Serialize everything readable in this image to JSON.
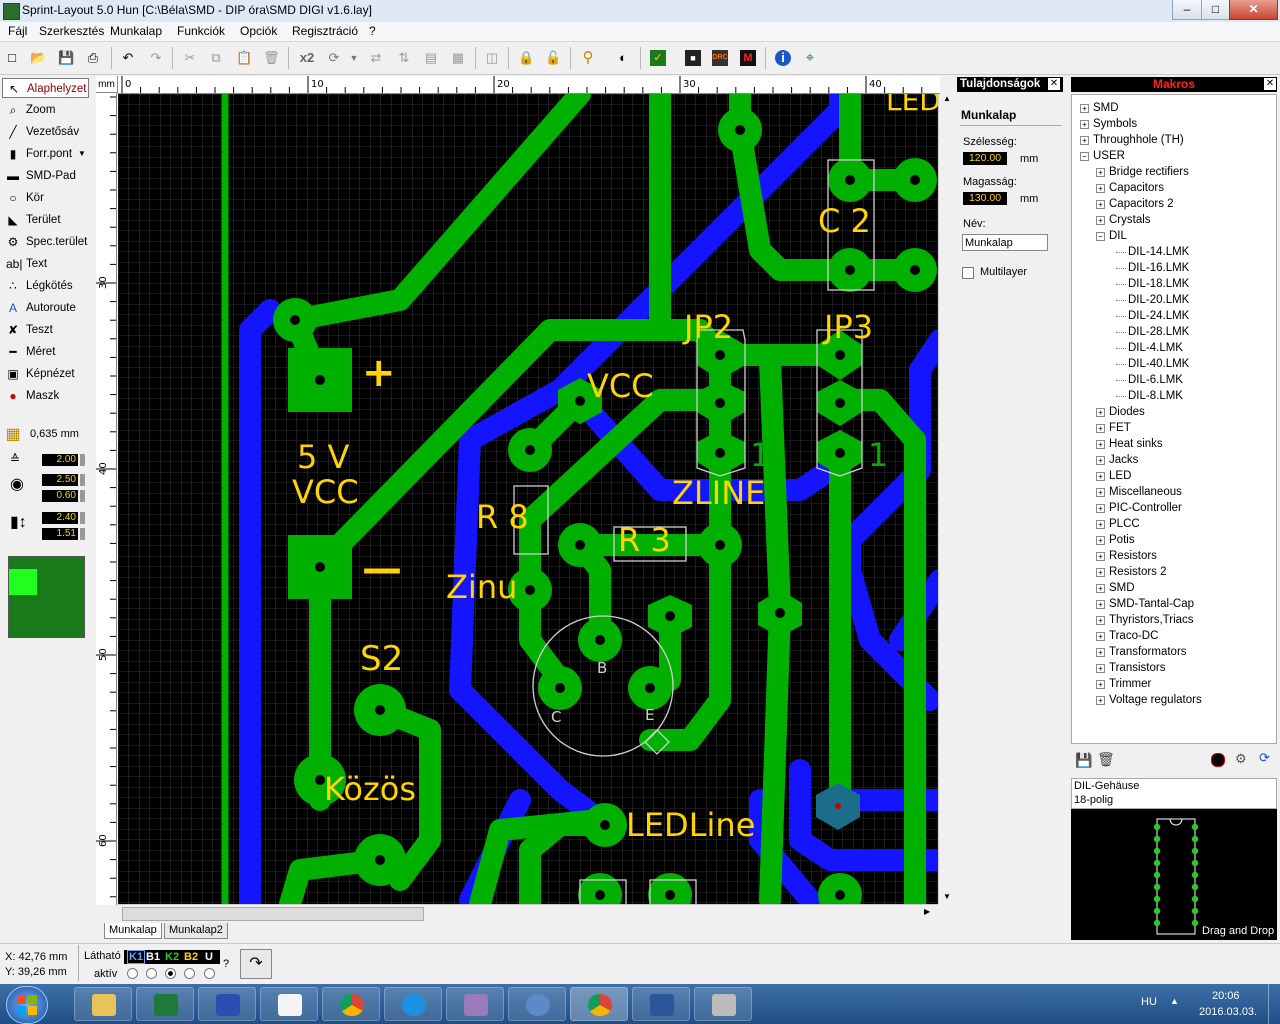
{
  "window": {
    "title": "Sprint-Layout 5.0 Hun     [C:\\Béla\\SMD - DIP óra\\SMD DIGI v1.6.lay]",
    "minimize": "–",
    "maximize": "□",
    "close": "✕"
  },
  "menu": [
    "Fájl",
    "Szerkesztés",
    "Munkalap",
    "Funkciók",
    "Opciók",
    "Regisztráció",
    "?"
  ],
  "toolbar": {
    "x2": "x2"
  },
  "tools": [
    {
      "label": "Alaphelyzet",
      "icon": "pointer-icon",
      "glyph": "↖"
    },
    {
      "label": "Zoom",
      "icon": "zoom-icon",
      "glyph": "⌕"
    },
    {
      "label": "Vezetősáv",
      "icon": "track-icon",
      "glyph": "╱"
    },
    {
      "label": "Forr.pont",
      "icon": "pad-icon",
      "glyph": "▮"
    },
    {
      "label": "SMD-Pad",
      "icon": "smd-pad-icon",
      "glyph": "▬"
    },
    {
      "label": "Kör",
      "icon": "circle-icon",
      "glyph": "○"
    },
    {
      "label": "Terület",
      "icon": "area-icon",
      "glyph": "◣"
    },
    {
      "label": "Spec.terület",
      "icon": "special-area-icon",
      "glyph": "⚙"
    },
    {
      "label": "Text",
      "icon": "text-icon",
      "glyph": "ab|"
    },
    {
      "label": "Légkötés",
      "icon": "airwire-icon",
      "glyph": "∴"
    },
    {
      "label": "Autoroute",
      "icon": "autoroute-icon",
      "glyph": "A"
    },
    {
      "label": "Teszt",
      "icon": "test-icon",
      "glyph": "✘"
    },
    {
      "label": "Méret",
      "icon": "measure-icon",
      "glyph": "━"
    },
    {
      "label": "Képnézet",
      "icon": "photo-icon",
      "glyph": "▣"
    },
    {
      "label": "Maszk",
      "icon": "mask-icon",
      "glyph": "●"
    }
  ],
  "grid": {
    "value": "0,635 mm"
  },
  "track_width": "2.00",
  "pad_outer": "2.50",
  "pad_inner": "0.60",
  "smd_w": "2.40",
  "smd_h": "1.51",
  "ruler": {
    "unit": "mm",
    "top": [
      "0",
      "10",
      "20",
      "30",
      "40"
    ],
    "left": [
      "30",
      "40",
      "50",
      "60"
    ]
  },
  "sheets": [
    "Munkalap",
    "Munkalap2"
  ],
  "pcb_labels": {
    "c2": "C 2",
    "jp2": "JP2",
    "jp3": "JP3",
    "plus": "+",
    "minus": "—",
    "fivev": "5 V",
    "vcc1": "VCC",
    "vcc2": "VCC",
    "r8": "R 8",
    "r3": "R 3",
    "zinu": "Zinu",
    "zline": "ZLINE",
    "s2": "S2",
    "kozos": "Közös",
    "ledline": "LEDLine",
    "one_a": "1",
    "one_b": "1",
    "b": "B",
    "c": "C",
    "e": "E",
    "top_partial": "LED"
  },
  "props": {
    "title": "Tulajdonságok",
    "section": "Munkalap",
    "width_label": "Szélesség:",
    "width": "120.00",
    "height_label": "Magasság:",
    "height": "130.00",
    "unit": "mm",
    "name_label": "Név:",
    "name": "Munkalap",
    "multilayer": "Multilayer"
  },
  "macros": {
    "title": "Makros",
    "top": [
      "SMD",
      "Symbols",
      "Throughhole (TH)",
      "USER"
    ],
    "user": [
      "Bridge rectifiers",
      "Capacitors",
      "Capacitors 2",
      "Crystals",
      "DIL"
    ],
    "dil": [
      "DIL-14.LMK",
      "DIL-16.LMK",
      "DIL-18.LMK",
      "DIL-20.LMK",
      "DIL-24.LMK",
      "DIL-28.LMK",
      "DIL-4.LMK",
      "DIL-40.LMK",
      "DIL-6.LMK",
      "DIL-8.LMK"
    ],
    "rest": [
      "Diodes",
      "FET",
      "Heat sinks",
      "Jacks",
      "LED",
      "Miscellaneous",
      "PIC-Controller",
      "PLCC",
      "Potis",
      "Resistors",
      "Resistors 2",
      "SMD",
      "SMD-Tantal-Cap",
      "Thyristors,Triacs",
      "Traco-DC",
      "Transformators",
      "Transistors",
      "Trimmer",
      "Voltage regulators"
    ],
    "desc1": "DIL-Gehäuse",
    "desc2": "18-polig",
    "drag": "Drag and Drop"
  },
  "status": {
    "x": "X:  42,76 mm",
    "y": "Y:  39,26 mm",
    "visible": "Látható",
    "active": "aktív",
    "layers": [
      "K1",
      "B1",
      "K2",
      "B2",
      "U"
    ],
    "help": "?"
  },
  "taskbar": {
    "lang": "HU",
    "time": "20:06",
    "date": "2016.03.03."
  },
  "colors": {
    "copper_top": "#00b000",
    "copper_bottom": "#1414ff",
    "silk": "#ffd400",
    "grid": "#5a5a5a"
  }
}
